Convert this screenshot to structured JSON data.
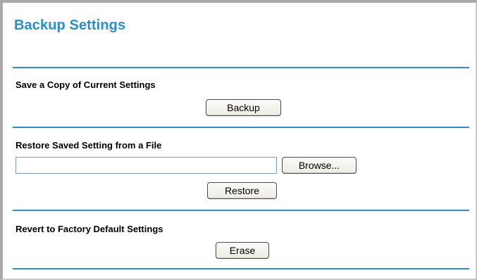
{
  "title": "Backup Settings",
  "sections": {
    "backup": {
      "label": "Save a Copy of Current Settings",
      "button_label": "Backup"
    },
    "restore": {
      "label": "Restore Saved Setting from a File",
      "file_value": "",
      "browse_label": "Browse...",
      "button_label": "Restore"
    },
    "erase": {
      "label": "Revert to Factory Default Settings",
      "button_label": "Erase"
    }
  },
  "colors": {
    "title": "#2a8fc4",
    "divider": "#2d8fc6"
  }
}
